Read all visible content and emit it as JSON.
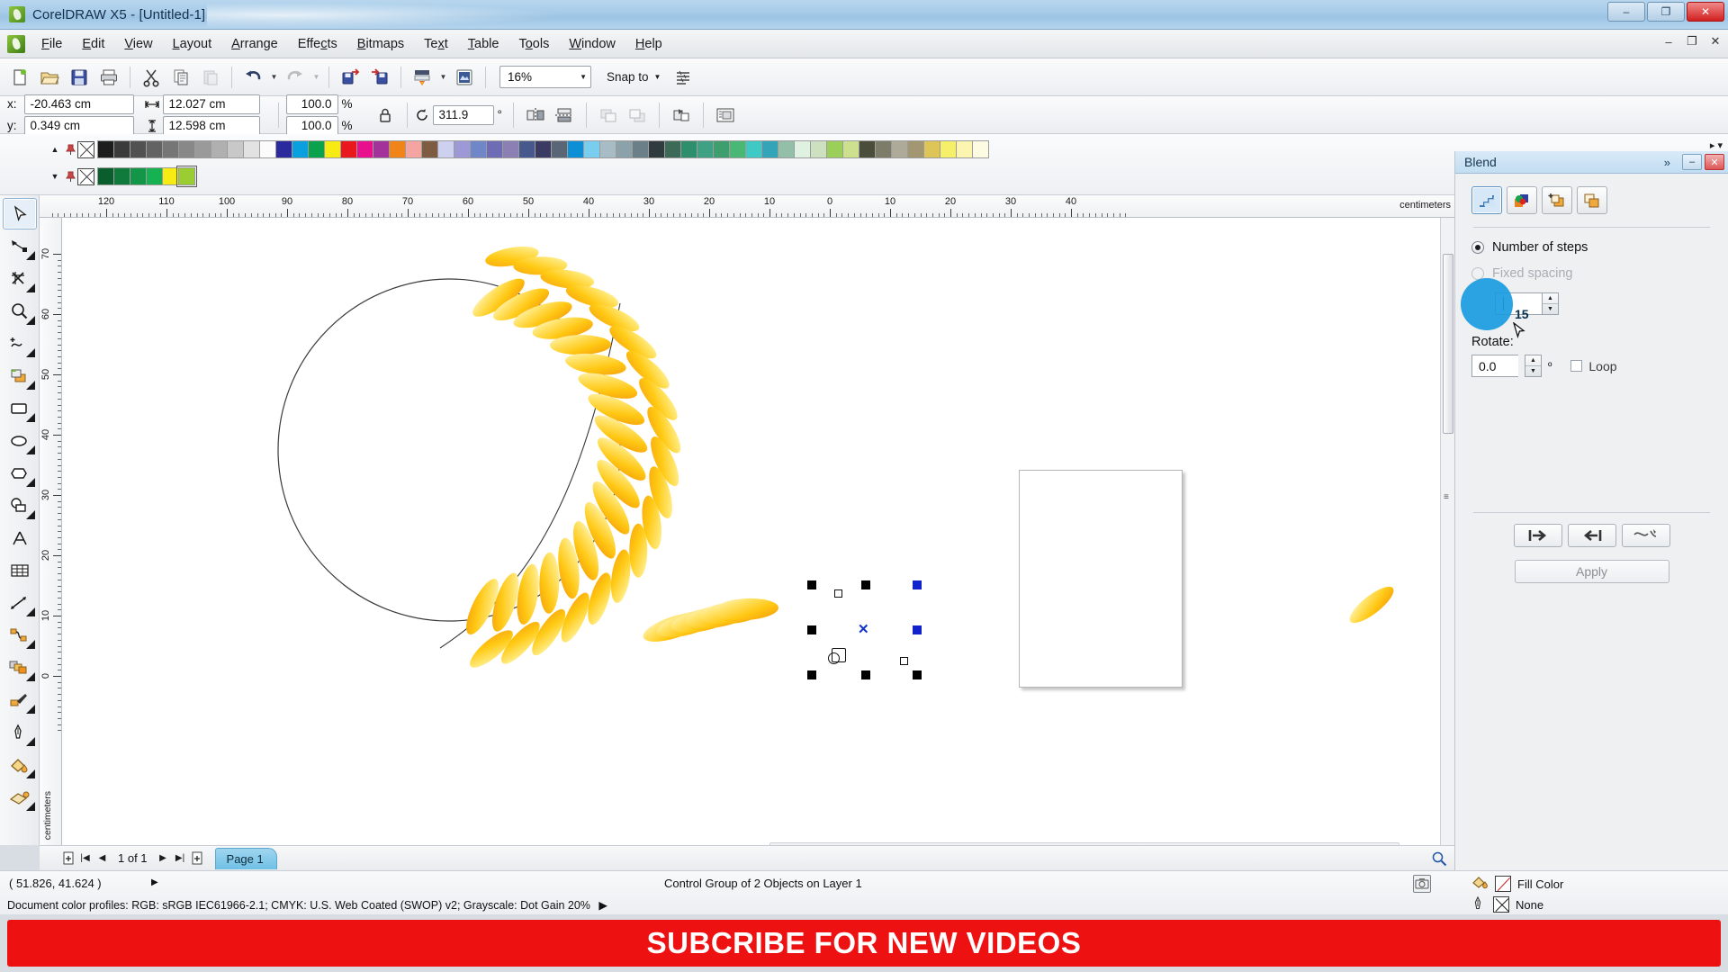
{
  "window": {
    "title": "CorelDRAW X5 - [Untitled-1]",
    "app_icon": "coreldraw-balloon-icon",
    "minimize": "–",
    "maximize": "❐",
    "close": "✕"
  },
  "menubar": {
    "items": [
      {
        "label": "File",
        "accel": "F"
      },
      {
        "label": "Edit",
        "accel": "E"
      },
      {
        "label": "View",
        "accel": "V"
      },
      {
        "label": "Layout",
        "accel": "L"
      },
      {
        "label": "Arrange",
        "accel": "A"
      },
      {
        "label": "Effects",
        "accel": "c"
      },
      {
        "label": "Bitmaps",
        "accel": "B"
      },
      {
        "label": "Text",
        "accel": "x"
      },
      {
        "label": "Table",
        "accel": "T"
      },
      {
        "label": "Tools",
        "accel": "o"
      },
      {
        "label": "Window",
        "accel": "W"
      },
      {
        "label": "Help",
        "accel": "H"
      }
    ],
    "doc_minimize": "–",
    "doc_restore": "❐",
    "doc_close": "✕"
  },
  "toolbar": {
    "buttons": [
      {
        "name": "new-document-icon",
        "label": "New"
      },
      {
        "name": "open-document-icon",
        "label": "Open"
      },
      {
        "name": "save-document-icon",
        "label": "Save"
      },
      {
        "name": "print-icon",
        "label": "Print"
      },
      {
        "name": "cut-icon",
        "label": "Cut"
      },
      {
        "name": "copy-icon",
        "label": "Copy"
      },
      {
        "name": "paste-icon",
        "label": "Paste"
      },
      {
        "name": "undo-icon",
        "label": "Undo"
      },
      {
        "name": "redo-icon",
        "label": "Redo"
      },
      {
        "name": "import-icon",
        "label": "Import"
      },
      {
        "name": "export-icon",
        "label": "Export"
      },
      {
        "name": "application-launcher-icon",
        "label": "Application Launcher"
      },
      {
        "name": "corel-online-icon",
        "label": "Corel Online"
      }
    ],
    "zoom_level": "16%",
    "snap_to_label": "Snap to",
    "options_icon": "options-icon"
  },
  "property_bar": {
    "x_label": "x:",
    "x_value": "-20.463 cm",
    "y_label": "y:",
    "y_value": "0.349 cm",
    "width_value": "12.027 cm",
    "height_value": "12.598 cm",
    "scale_h": "100.0",
    "scale_v": "100.0",
    "percent": "%",
    "lock_icon": "lock-ratio-icon",
    "rotation_value": "311.9",
    "degree": "°",
    "mirror_h_icon": "mirror-horizontal-icon",
    "mirror_v_icon": "mirror-vertical-icon",
    "to_front_icon": "to-front-icon",
    "to_back_icon": "to-back-icon",
    "convert_outline_icon": "convert-outline-icon",
    "wrap_text_icon": "wrap-paragraph-text-icon"
  },
  "palette": {
    "no_color_label": "none-swatch",
    "row1": [
      "#1d1d1d",
      "#3b3b3b",
      "#515151",
      "#636363",
      "#767676",
      "#888888",
      "#9a9a9a",
      "#b0b0b0",
      "#c8c8c8",
      "#e2e2e2",
      "#fbfbfb",
      "#2a2a9c",
      "#0aa0e0",
      "#0ba24e",
      "#f6eb12",
      "#e8181c",
      "#e8108c",
      "#a3339b",
      "#f08418",
      "#f4a5a2",
      "#7d5c42",
      "#cdd0ee",
      "#9d99d6",
      "#6f86c9",
      "#6e6cb5",
      "#8b7fb3",
      "#47588d",
      "#3b3a63",
      "#5a6576",
      "#0d8fd6",
      "#79cef0",
      "#a8bcc6",
      "#8ba2ab",
      "#6a7f88",
      "#2f3b3f",
      "#3d6a57",
      "#2e8f6d",
      "#3fa184",
      "#3e9e6d",
      "#49b874",
      "#3ec9c4",
      "#34a4b8",
      "#93bfa8",
      "#dff1e0",
      "#cde0c0",
      "#9ccf5a",
      "#cde08e",
      "#4a4d3a",
      "#7d7c68",
      "#aeaa99",
      "#a39771",
      "#ddc557",
      "#f6ef6a",
      "#fbf5b0",
      "#fdfbe2"
    ],
    "row2": [
      "#0a5e2e",
      "#0f7a3c",
      "#139647",
      "#15b152",
      "#f6eb12",
      "#9acd32"
    ],
    "prev_arrow": "▲",
    "next_arrow": "▼",
    "collapse_icon": "collapse-palette-icon"
  },
  "toolbox": {
    "tools": [
      {
        "name": "pick-tool",
        "label": "Pick",
        "active": true
      },
      {
        "name": "shape-tool",
        "label": "Shape"
      },
      {
        "name": "crop-tool",
        "label": "Crop"
      },
      {
        "name": "zoom-tool",
        "label": "Zoom"
      },
      {
        "name": "freehand-tool",
        "label": "Freehand"
      },
      {
        "name": "smart-fill-tool",
        "label": "Smart Fill"
      },
      {
        "name": "rectangle-tool",
        "label": "Rectangle"
      },
      {
        "name": "ellipse-tool",
        "label": "Ellipse"
      },
      {
        "name": "polygon-tool",
        "label": "Polygon"
      },
      {
        "name": "basic-shapes-tool",
        "label": "Basic Shapes"
      },
      {
        "name": "text-tool",
        "label": "Text"
      },
      {
        "name": "table-tool",
        "label": "Table"
      },
      {
        "name": "dimension-tool",
        "label": "Dimension"
      },
      {
        "name": "connector-tool",
        "label": "Connector"
      },
      {
        "name": "blend-tool",
        "label": "Blend"
      },
      {
        "name": "color-eyedropper-tool",
        "label": "Color Eyedropper"
      },
      {
        "name": "outline-tool",
        "label": "Outline"
      },
      {
        "name": "fill-tool",
        "label": "Fill"
      },
      {
        "name": "interactive-fill-tool",
        "label": "Interactive Fill"
      }
    ]
  },
  "rulers": {
    "unit": "centimeters",
    "unit_vertical": "centimeters",
    "h_ticks": [
      120,
      110,
      100,
      90,
      80,
      70,
      60,
      50,
      40,
      30,
      20,
      10,
      0,
      10,
      20,
      30,
      40
    ],
    "v_ticks": [
      70,
      60,
      50,
      40,
      30,
      20,
      10,
      0
    ]
  },
  "canvas": {
    "selection_status": "selected-object-handles",
    "blend_control_curve": "control-curve-path"
  },
  "page_navigator": {
    "add_page_start_icon": "add-page-icon",
    "first_icon": "|◀",
    "prev_icon": "◀",
    "counter": "1 of 1",
    "next_icon": "▶",
    "last_icon": "▶|",
    "add_page_end_icon": "add-page-icon",
    "tab_label": "Page 1"
  },
  "status_bar": {
    "coordinates": "( 51.826, 41.624 )",
    "expand_arrow": "▶",
    "object_info": "Control Group of 2 Objects on Layer 1",
    "color_profiles": "Document color profiles: RGB: sRGB IEC61966-2.1; CMYK: U.S. Web Coated (SWOP) v2; Grayscale: Dot Gain 20%",
    "profiles_arrow": "▶",
    "fill_label": "Fill Color",
    "outline_label": "None",
    "snapshot_icon": "snapshot-icon",
    "fill-bucket-icon": "fill-bucket-icon",
    "outline-pen-icon": "outline-pen-icon"
  },
  "docker": {
    "title": "Blend",
    "chevron": "»",
    "minimize": "–",
    "close": "✕",
    "modes": [
      {
        "name": "blend-steps-mode-icon",
        "label": "Steps",
        "selected": true
      },
      {
        "name": "blend-acceleration-mode-icon",
        "label": "Acceleration"
      },
      {
        "name": "blend-color-mode-icon",
        "label": "Color"
      },
      {
        "name": "blend-misc-mode-icon",
        "label": "Miscellaneous"
      }
    ],
    "number_of_steps_label": "Number of steps",
    "fixed_spacing_label": "Fixed spacing",
    "steps_value": "15",
    "rotate_label": "Rotate:",
    "rotate_value": "0.0",
    "degree": "º",
    "loop_label": "Loop",
    "buttons": [
      {
        "name": "start-object-button",
        "label": "⇥"
      },
      {
        "name": "end-object-button",
        "label": "⇤"
      },
      {
        "name": "path-properties-button",
        "label": "path-curve-icon"
      }
    ],
    "apply_label": "Apply",
    "highlight_color": "#1a9be0"
  },
  "banner": {
    "text": "SUBCRIBE FOR NEW VIDEOS",
    "bg_color": "#ee1111",
    "text_color": "#ffffff"
  }
}
